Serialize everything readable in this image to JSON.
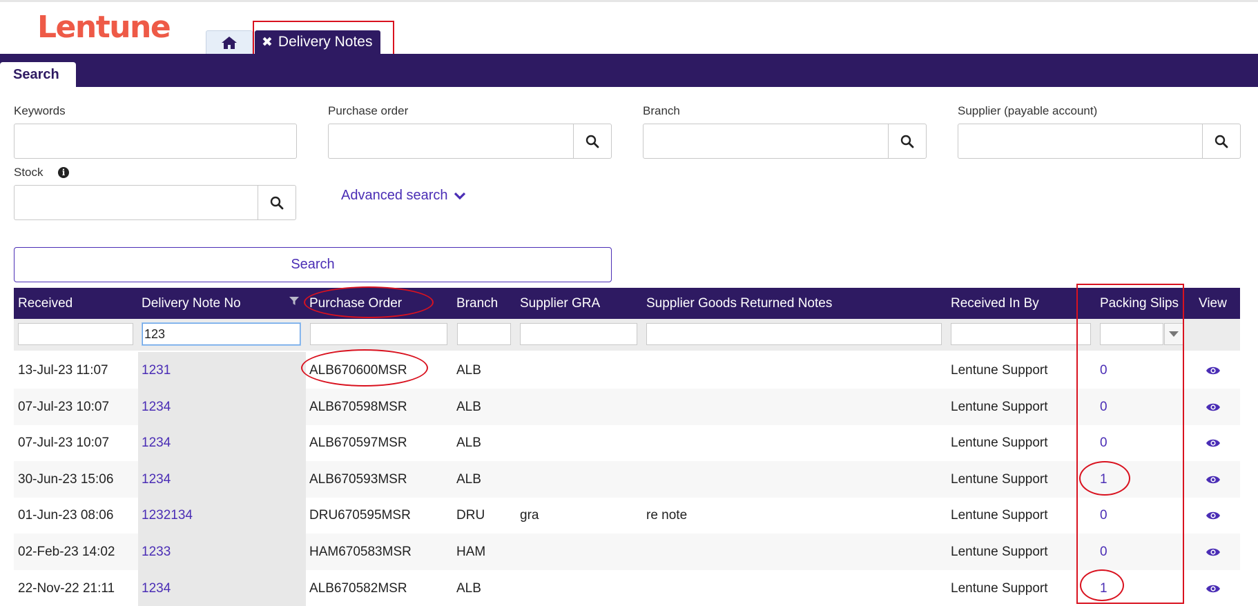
{
  "app": {
    "logo": "Lentune"
  },
  "tabs": {
    "active_label": "Delivery Notes",
    "close_symbol": "✖"
  },
  "subtab": {
    "label": "Search"
  },
  "fields": {
    "keywords": {
      "label": "Keywords",
      "value": ""
    },
    "purchase_order": {
      "label": "Purchase order",
      "value": ""
    },
    "branch": {
      "label": "Branch",
      "value": ""
    },
    "supplier": {
      "label": "Supplier (payable account)",
      "value": ""
    },
    "stock": {
      "label": "Stock",
      "value": ""
    }
  },
  "advanced_search": "Advanced search",
  "search_button": "Search",
  "grid": {
    "columns": [
      "Received",
      "Delivery Note No",
      "Purchase Order",
      "Branch",
      "Supplier GRA",
      "Supplier Goods Returned Notes",
      "Received In By",
      "Packing Slips",
      "View"
    ],
    "filters": {
      "delivery_note_no": "123"
    },
    "rows": [
      {
        "received": "13-Jul-23 11:07",
        "dn": "1231",
        "po": "ALB670600MSR",
        "branch": "ALB",
        "gra": "",
        "grn": "",
        "by": "Lentune Support",
        "slips": "0"
      },
      {
        "received": "07-Jul-23 10:07",
        "dn": "1234",
        "po": "ALB670598MSR",
        "branch": "ALB",
        "gra": "",
        "grn": "",
        "by": "Lentune Support",
        "slips": "0"
      },
      {
        "received": "07-Jul-23 10:07",
        "dn": "1234",
        "po": "ALB670597MSR",
        "branch": "ALB",
        "gra": "",
        "grn": "",
        "by": "Lentune Support",
        "slips": "0"
      },
      {
        "received": "30-Jun-23 15:06",
        "dn": "1234",
        "po": "ALB670593MSR",
        "branch": "ALB",
        "gra": "",
        "grn": "",
        "by": "Lentune Support",
        "slips": "1"
      },
      {
        "received": "01-Jun-23 08:06",
        "dn": "1232134",
        "po": "DRU670595MSR",
        "branch": "DRU",
        "gra": "gra",
        "grn": "re note",
        "by": "Lentune Support",
        "slips": "0"
      },
      {
        "received": "02-Feb-23 14:02",
        "dn": "1233",
        "po": "HAM670583MSR",
        "branch": "HAM",
        "gra": "",
        "grn": "",
        "by": "Lentune Support",
        "slips": "0"
      },
      {
        "received": "22-Nov-22 21:11",
        "dn": "1234",
        "po": "ALB670582MSR",
        "branch": "ALB",
        "gra": "",
        "grn": "",
        "by": "Lentune Support",
        "slips": "1"
      }
    ]
  },
  "colors": {
    "brand_purple": "#2e1a62",
    "link_purple": "#4a2db5",
    "logo_red": "#ee5a47",
    "annotation_red": "#d9121f"
  },
  "icons": [
    "home-icon",
    "search-icon",
    "info-icon",
    "chevron-down-icon",
    "filter-icon",
    "dropdown-arrow-icon",
    "eye-icon"
  ]
}
